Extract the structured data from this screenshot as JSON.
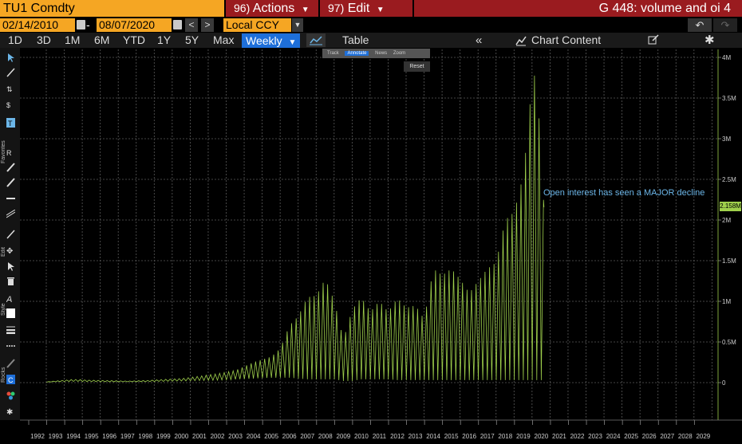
{
  "header": {
    "ticker": "TU1 Comdty",
    "actions_num": "96)",
    "actions_label": "Actions",
    "edit_num": "97)",
    "edit_label": "Edit",
    "graph_title": "G 448: volume and oi 4"
  },
  "range_bar": {
    "start_date": "02/14/2010",
    "end_date": "08/07/2020",
    "dash": "-",
    "currency": "Local CCY"
  },
  "toolbar": {
    "periods": [
      "1D",
      "3D",
      "1M",
      "6M",
      "YTD",
      "1Y",
      "5Y",
      "Max"
    ],
    "frequency": "Weekly",
    "table_label": "Table",
    "chart_content_label": "Chart Content"
  },
  "tooltip_bar": {
    "track": "Track",
    "annotate": "Annotate",
    "news": "News",
    "zoom": "Zoom",
    "reset": "Reset"
  },
  "side_labels": {
    "favorites": "Favorites",
    "edit": "Edit",
    "style": "Style",
    "rocks": "Rocks"
  },
  "icons": [
    "chevron-down-icon",
    "calendar-icon",
    "undo-icon",
    "redo-icon",
    "line-chart-icon",
    "collapse-icon",
    "chart-content-icon",
    "edit-icon",
    "gear-icon",
    "cursor-icon"
  ],
  "colors": {
    "series": "#9fd04c",
    "annotation": "#6cb6e8",
    "ticker_bg": "#f5a623",
    "menu_bg": "#9a1b1f",
    "weekly_bg": "#1e6fd9"
  },
  "chart_data": {
    "type": "line",
    "title": "",
    "xlabel": "",
    "ylabel": "",
    "x_tick_labels": [
      "1992",
      "1993",
      "1994",
      "1995",
      "1996",
      "1997",
      "1998",
      "1999",
      "2000",
      "2001",
      "2002",
      "2003",
      "2004",
      "2005",
      "2006",
      "2007",
      "2008",
      "2009",
      "2010",
      "2011",
      "2012",
      "2013",
      "2014",
      "2015",
      "2016",
      "2017",
      "2018",
      "2019",
      "2020",
      "2021",
      "2022",
      "2023",
      "2024",
      "2025",
      "2026",
      "2027",
      "2028",
      "2029"
    ],
    "y_tick_labels": [
      "0",
      "0.5M",
      "1M",
      "1.5M",
      "2M",
      "2.5M",
      "3M",
      "3.5M",
      "4M"
    ],
    "ylim": [
      0,
      4000000
    ],
    "xlim": [
      1992,
      2030
    ],
    "grid": true,
    "last_value_label": "2.158M",
    "last_value": 2158000,
    "annotation": "Open interest has seen a MAJOR decline",
    "series_envelope": {
      "x": [
        1992.5,
        1993,
        1994,
        1995,
        1996,
        1997,
        1998,
        1999,
        2000,
        2001,
        2002,
        2003,
        2004,
        2005,
        2005.5,
        2006,
        2006.5,
        2007,
        2007.5,
        2008,
        2008.5,
        2009,
        2009.5,
        2010,
        2010.5,
        2011,
        2011.5,
        2012,
        2012.5,
        2013,
        2013.5,
        2014,
        2014.5,
        2015,
        2015.5,
        2016,
        2016.5,
        2017,
        2017.5,
        2018,
        2018.5,
        2019,
        2019.25,
        2019.5,
        2019.75,
        2020,
        2020.15
      ],
      "peaks": [
        10000,
        20000,
        40000,
        30000,
        25000,
        20000,
        25000,
        40000,
        50000,
        80000,
        110000,
        150000,
        250000,
        320000,
        420000,
        700000,
        820000,
        1050000,
        1070000,
        1280000,
        1000000,
        530000,
        900000,
        1050000,
        870000,
        1000000,
        870000,
        1040000,
        920000,
        950000,
        780000,
        1400000,
        1320000,
        1400000,
        1270000,
        1100000,
        1250000,
        1400000,
        1480000,
        2000000,
        2100000,
        2550000,
        3100000,
        3750000,
        3800000,
        2700000,
        2158000
      ],
      "troughs": [
        5000,
        10000,
        15000,
        12000,
        10000,
        10000,
        12000,
        15000,
        20000,
        25000,
        30000,
        40000,
        50000,
        60000,
        60000,
        60000,
        50000,
        40000,
        40000,
        40000,
        40000,
        20000,
        20000,
        40000,
        40000,
        40000,
        40000,
        30000,
        30000,
        30000,
        30000,
        30000,
        30000,
        30000,
        30000,
        30000,
        30000,
        30000,
        30000,
        30000,
        30000,
        30000,
        30000,
        30000,
        30000,
        30000,
        2158000
      ]
    },
    "cycle_years": 0.25
  }
}
